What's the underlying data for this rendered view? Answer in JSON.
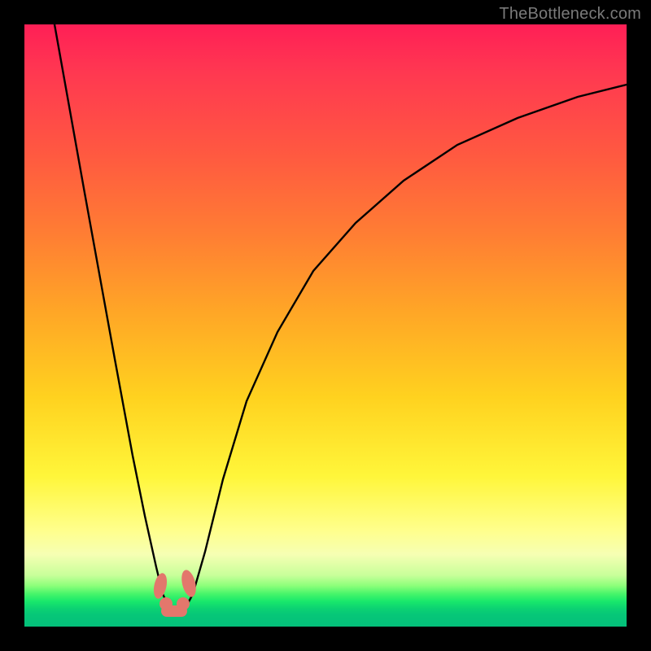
{
  "watermark": "TheBottleneck.com",
  "chart_data": {
    "type": "line",
    "title": "",
    "xlabel": "",
    "ylabel": "",
    "xlim": [
      0,
      100
    ],
    "ylim": [
      0,
      100
    ],
    "series": [
      {
        "name": "bottleneck-curve",
        "color": "#000000",
        "x": [
          5,
          10,
          15,
          18,
          20,
          22,
          23,
          24,
          25,
          26,
          27,
          28,
          30,
          33,
          37,
          42,
          48,
          55,
          63,
          72,
          82,
          92,
          100
        ],
        "y": [
          100,
          72,
          44,
          28,
          18,
          9,
          5,
          3,
          2,
          2,
          3,
          5,
          12,
          24,
          37,
          49,
          59,
          67,
          74,
          80,
          84,
          88,
          90
        ]
      },
      {
        "name": "highlight-blob",
        "color": "#e3776c",
        "x": [
          22.5,
          23.2,
          24.0,
          25.0,
          26.0,
          27.0,
          27.8
        ],
        "y": [
          8.5,
          5.0,
          3.0,
          2.2,
          2.5,
          5.0,
          9.0
        ]
      }
    ],
    "note": "Values estimated from pixel positions; axes are unlabeled in source so x/y are normalized 0-100."
  },
  "colors": {
    "background": "#000000",
    "curve": "#000000",
    "highlight": "#e3776c",
    "gradient_top": "#ff1f56",
    "gradient_bottom": "#04c07a"
  }
}
